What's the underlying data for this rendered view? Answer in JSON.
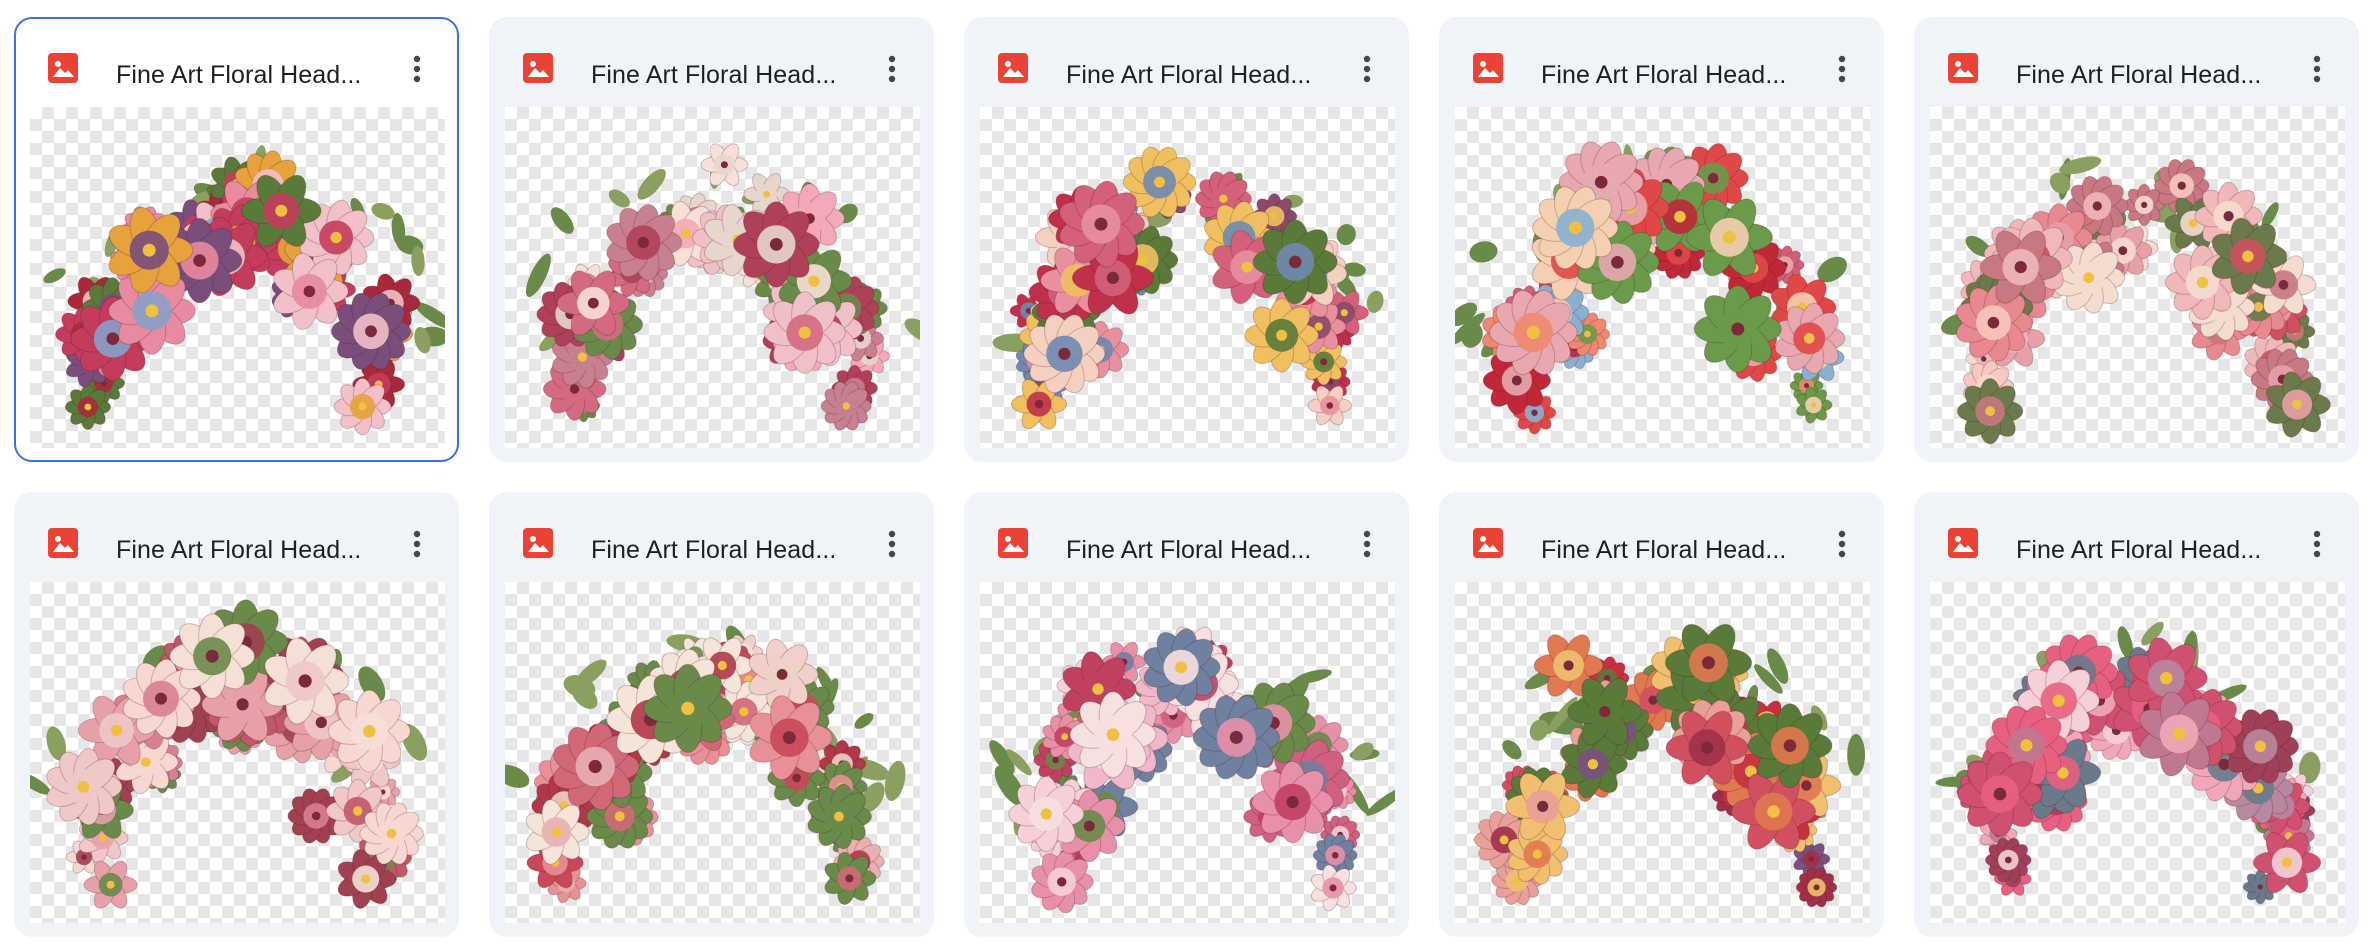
{
  "files": [
    {
      "title": "Fine Art Floral Head...",
      "selected": true,
      "palette": [
        "#c43c5c",
        "#e88aa0",
        "#7a4d7a",
        "#e6a23c",
        "#8aa0c8",
        "#a82a3a",
        "#f2c0c8",
        "#5a7a3a"
      ]
    },
    {
      "title": "Fine Art Floral Head...",
      "selected": false,
      "palette": [
        "#d46a80",
        "#f0c0c8",
        "#e8d6cc",
        "#b04058",
        "#f5a8b8",
        "#6a8a4a",
        "#c88090",
        "#f7e0d6"
      ]
    },
    {
      "title": "Fine Art Floral Head...",
      "selected": false,
      "palette": [
        "#c0304a",
        "#e8909e",
        "#7088b0",
        "#f0c060",
        "#8a4a6a",
        "#d4607a",
        "#f5d0c0",
        "#5a7a3a"
      ]
    },
    {
      "title": "Fine Art Floral Head...",
      "selected": false,
      "palette": [
        "#e04848",
        "#f08870",
        "#8ab0d0",
        "#c02838",
        "#f5d0b0",
        "#d0607a",
        "#6a9a4a",
        "#e8a8b0"
      ]
    },
    {
      "title": "Fine Art Floral Head...",
      "selected": false,
      "palette": [
        "#f0b8b8",
        "#e88890",
        "#d05060",
        "#f5dcd0",
        "#c87880",
        "#f7c8c0",
        "#6a7a4a",
        "#e8a0a8"
      ]
    },
    {
      "title": "Fine Art Floral Head...",
      "selected": false,
      "palette": [
        "#f0c8c8",
        "#c05868",
        "#f5e0d6",
        "#d88090",
        "#e8a0a8",
        "#6a8a4a",
        "#a04050",
        "#f7d8d0"
      ]
    },
    {
      "title": "Fine Art Floral Head...",
      "selected": false,
      "palette": [
        "#c84858",
        "#f0d0c8",
        "#e89098",
        "#b03848",
        "#f5e4d8",
        "#d06878",
        "#6a8a4a",
        "#e8b0b0"
      ]
    },
    {
      "title": "Fine Art Floral Head...",
      "selected": false,
      "palette": [
        "#e890a8",
        "#f5d0d8",
        "#c04060",
        "#f0b8c8",
        "#7080a0",
        "#d06080",
        "#f7e0e0",
        "#6a8a4a"
      ]
    },
    {
      "title": "Fine Art Floral Head...",
      "selected": false,
      "palette": [
        "#c83040",
        "#e07850",
        "#7a5080",
        "#f0c070",
        "#d05060",
        "#e8a098",
        "#a03048",
        "#5a7a3a"
      ]
    },
    {
      "title": "Fine Art Floral Head...",
      "selected": false,
      "palette": [
        "#d05070",
        "#f0a8b8",
        "#c07890",
        "#e86080",
        "#f5d0d8",
        "#a04058",
        "#6a7a8a",
        "#b888a0"
      ]
    }
  ],
  "icons": {
    "file": "image-file-icon",
    "menu": "more-vert-icon"
  }
}
